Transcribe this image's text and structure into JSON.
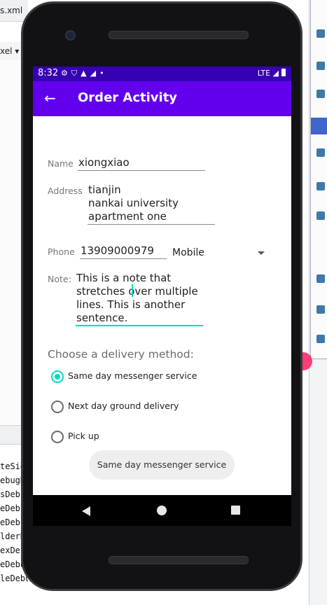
{
  "ide": {
    "tab_fragment": "s.xml",
    "row_fragment": "xel ▾",
    "console_lines": [
      "teSig",
      "ebugR",
      "sDebu",
      "eDebu",
      "eDebu",
      "lderD",
      "exDeb",
      "eDebu",
      "leDebu"
    ]
  },
  "status_bar": {
    "time": "8:32",
    "icons": [
      "gear-icon",
      "shield-icon",
      "a-icon",
      "signal-icon",
      "dot-icon"
    ],
    "network": "LTE"
  },
  "app_bar": {
    "title": "Order Activity",
    "back_icon": "arrow-back-icon"
  },
  "form": {
    "name_label": "Name",
    "name_value": "xiongxiao",
    "address_label": "Address",
    "address_lines": [
      "tianjin",
      "nankai university",
      "apartment one"
    ],
    "phone_label": "Phone",
    "phone_value": "13909000979",
    "phone_type": "Mobile",
    "note_label": "Note:",
    "note_lines": [
      "This is a note that",
      "stretches over multiple",
      "lines. This is another",
      "sentence."
    ]
  },
  "delivery": {
    "title": "Choose a delivery method:",
    "options": [
      {
        "label": "Same day messenger service",
        "checked": true
      },
      {
        "label": "Next day ground delivery",
        "checked": false
      },
      {
        "label": "Pick up",
        "checked": false
      }
    ]
  },
  "toast": "Same day messenger service",
  "colors": {
    "status_bar": "#3700b3",
    "app_bar": "#6200ee",
    "accent": "#03dac5"
  }
}
